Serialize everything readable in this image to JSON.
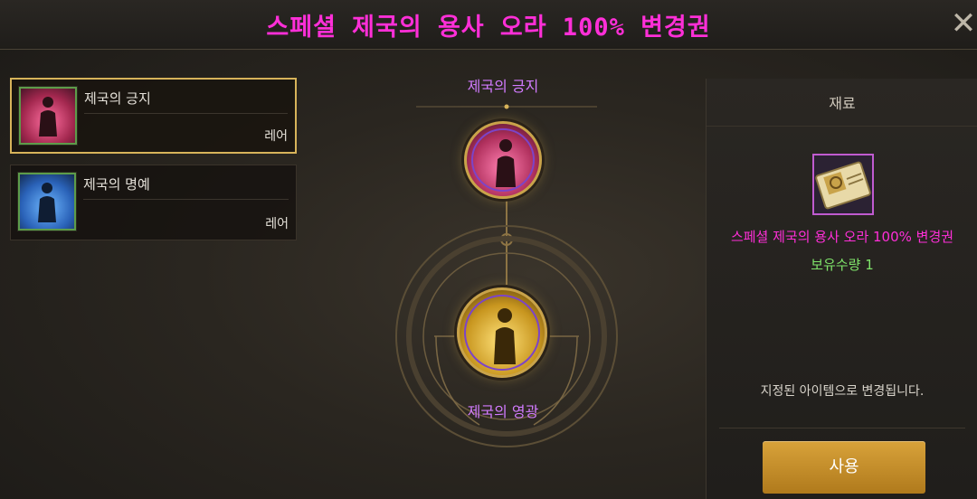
{
  "title": "스페셜 제국의 용사 오라 100% 변경권",
  "close_label": "✕",
  "items": [
    {
      "name": "제국의 긍지",
      "rarity": "레어",
      "color": "#e0557f",
      "selected": true
    },
    {
      "name": "제국의 명예",
      "rarity": "레어",
      "color": "#3f8fe0",
      "selected": false
    }
  ],
  "center": {
    "top_label": "제국의 긍지",
    "top_color": "#e0557f",
    "bottom_label": "제국의 영광",
    "bottom_color": "#e2b93a"
  },
  "panel": {
    "header": "재료",
    "material_name": "스페셜 제국의 용사 오라 100% 변경권",
    "material_count": "보유수량 1",
    "description": "지정된 아이템으로 변경됩니다.",
    "use_button": "사용"
  },
  "colors": {
    "title": "#ff2fd8",
    "accent_gold": "#c9a34a",
    "count_green": "#7fe36a",
    "label_purple": "#d27bff"
  },
  "icons": [
    "close-icon",
    "aura-figure-icon",
    "ticket-icon"
  ]
}
